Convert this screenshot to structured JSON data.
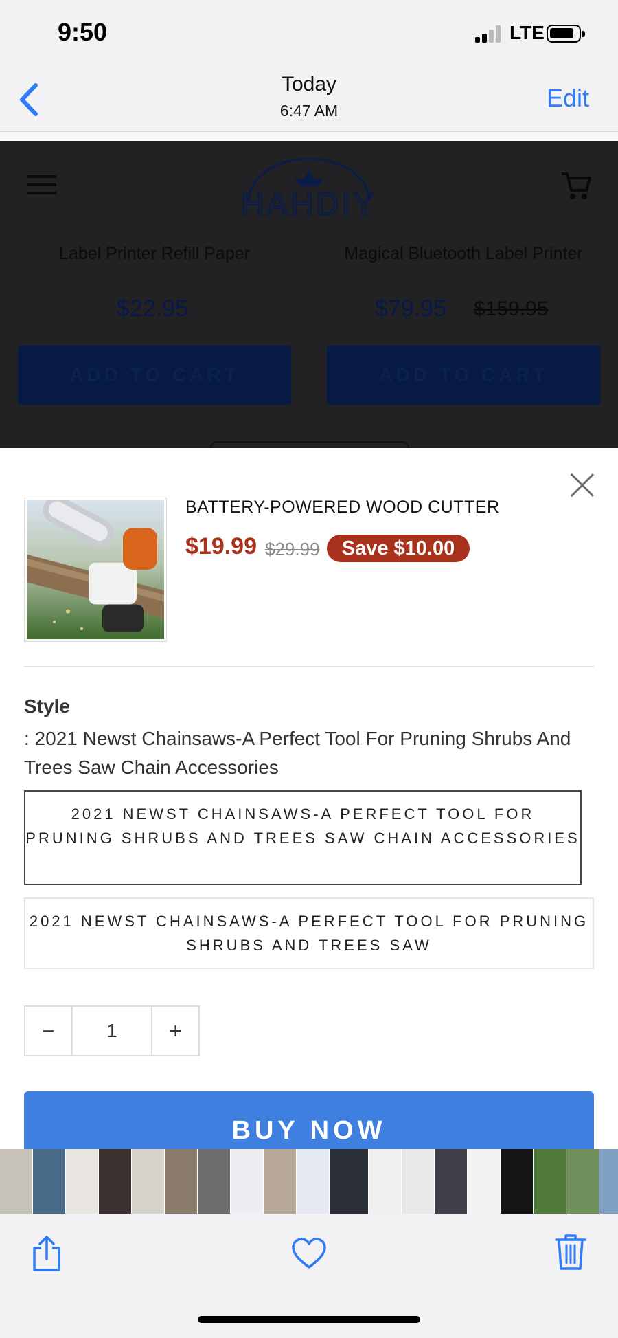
{
  "status_bar": {
    "time": "9:50",
    "network": "LTE"
  },
  "photos_nav": {
    "title": "Today",
    "subtitle": "6:47 AM",
    "edit_label": "Edit"
  },
  "background_page": {
    "logo_text": "HAHDIY",
    "products": [
      {
        "name": "Label Printer Refill Paper",
        "price": "$22.95",
        "button": "ADD TO CART"
      },
      {
        "name": "Magical Bluetooth Label Printer",
        "price": "$79.95",
        "compare_price": "$159.95",
        "button": "ADD TO CART"
      }
    ]
  },
  "modal": {
    "product_title": "BATTERY-POWERED WOOD CUTTER",
    "price": "$19.99",
    "compare_price": "$29.99",
    "save_badge": "Save $10.00",
    "style_label": "Style",
    "style_value": ": 2021 Newst Chainsaws-A Perfect Tool For Pruning Shrubs And Trees Saw Chain Accessories",
    "options": [
      "2021 NEWST CHAINSAWS-A PERFECT TOOL FOR PRUNING SHRUBS AND TREES SAW CHAIN ACCESSORIES",
      "2021 NEWST CHAINSAWS-A PERFECT TOOL FOR PRUNING SHRUBS AND TREES SAW"
    ],
    "quantity": {
      "minus": "−",
      "value": "1",
      "plus": "+"
    },
    "buy_now_label": "BUY NOW"
  },
  "colors": {
    "accent_blue": "#2f7cf6",
    "price_red": "#a8321b",
    "buy_button": "#3f7fe0",
    "overlay_dark": "#222224"
  },
  "icons": [
    "back-chevron-icon",
    "menu-icon",
    "cart-icon",
    "close-icon",
    "share-icon",
    "heart-icon",
    "trash-icon"
  ]
}
